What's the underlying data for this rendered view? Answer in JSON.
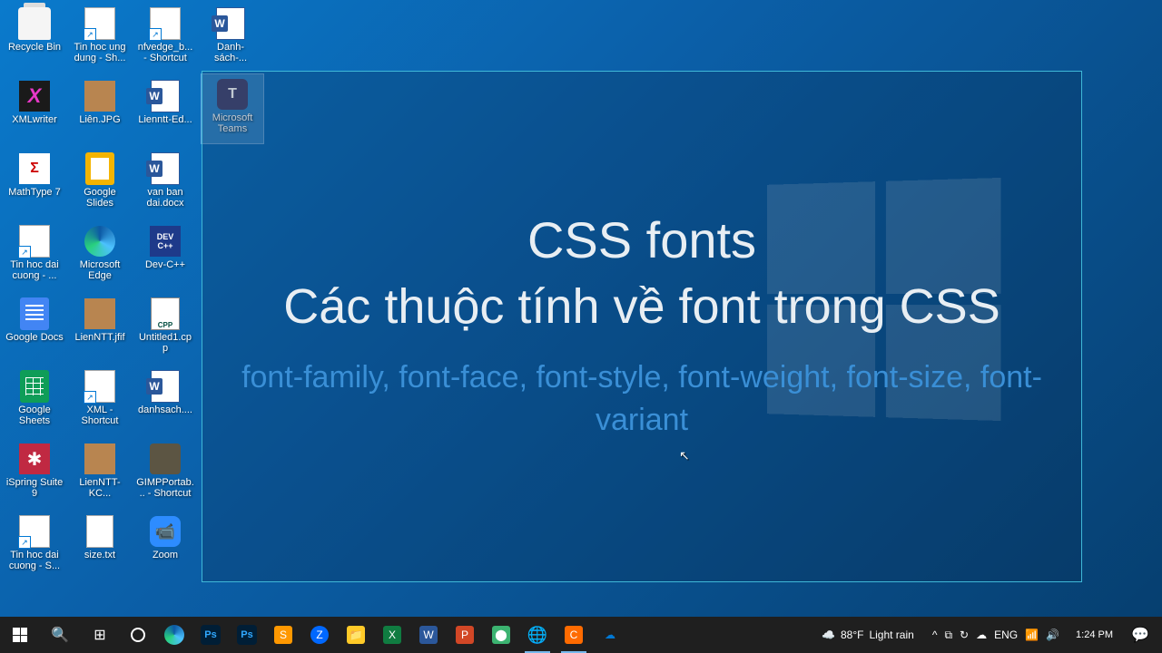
{
  "icons": {
    "c1": [
      {
        "name": "recycle-bin",
        "label": "Recycle Bin",
        "glyph": "bin"
      },
      {
        "name": "xmlwriter",
        "label": "XMLwriter",
        "glyph": "xm"
      },
      {
        "name": "mathtype",
        "label": "MathType 7",
        "glyph": "mt"
      },
      {
        "name": "tin-hoc-dai-cuong",
        "label": "Tin hoc dai cuong - ...",
        "glyph": "short"
      },
      {
        "name": "google-docs",
        "label": "Google Docs",
        "glyph": "gdoc"
      },
      {
        "name": "google-sheets",
        "label": "Google Sheets",
        "glyph": "gsh"
      },
      {
        "name": "ispring",
        "label": "iSpring Suite 9",
        "glyph": "ispr"
      },
      {
        "name": "tin-hoc-dai-cuong-s",
        "label": "Tin hoc dai cuong - S...",
        "glyph": "short"
      }
    ],
    "c2": [
      {
        "name": "tin-hoc-ung-dung",
        "label": "Tin hoc ung dung - Sh...",
        "glyph": "short"
      },
      {
        "name": "lien-jpg",
        "label": "Liên.JPG",
        "glyph": "photo"
      },
      {
        "name": "google-slides",
        "label": "Google Slides",
        "glyph": "gsl"
      },
      {
        "name": "microsoft-edge",
        "label": "Microsoft Edge",
        "glyph": "edge"
      },
      {
        "name": "lienntt-jfif",
        "label": "LienNTT.jfif",
        "glyph": "photo"
      },
      {
        "name": "xml-shortcut",
        "label": "XML - Shortcut",
        "glyph": "short"
      },
      {
        "name": "lienntt-kc",
        "label": "LienNTT-KC...",
        "glyph": "photo"
      },
      {
        "name": "size-txt",
        "label": "size.txt",
        "glyph": "txt"
      }
    ],
    "c3": [
      {
        "name": "nfvedge",
        "label": "nfvedge_b... - Shortcut",
        "glyph": "short"
      },
      {
        "name": "lienntt-ed",
        "label": "Lienntt-Ed...",
        "glyph": "word"
      },
      {
        "name": "van-ban-dai",
        "label": "van ban dai.docx",
        "glyph": "word"
      },
      {
        "name": "dev-cpp",
        "label": "Dev-C++",
        "glyph": "dev"
      },
      {
        "name": "untitled1-cpp",
        "label": "Untitled1.cpp",
        "glyph": "cpp"
      },
      {
        "name": "danhsach",
        "label": "danhsach....",
        "glyph": "word"
      },
      {
        "name": "gimp",
        "label": "GIMPPortab... - Shortcut",
        "glyph": "gimp"
      },
      {
        "name": "zoom",
        "label": "Zoom",
        "glyph": "zoom"
      }
    ],
    "c4": [
      {
        "name": "danh-sach",
        "label": "Danh-sách-...",
        "glyph": "word"
      }
    ],
    "teams": {
      "name": "microsoft-teams",
      "label": "Microsoft Teams",
      "glyph": "teams"
    }
  },
  "overlay": {
    "title": "CSS fonts",
    "subtitle": "Các thuộc tính về font trong CSS",
    "props": "font-family, font-face, font-style, font-weight, font-size, font-variant"
  },
  "taskbar": {
    "weather_temp": "88°F",
    "weather_text": "Light rain",
    "lang": "ENG",
    "time": "1:24 PM"
  }
}
